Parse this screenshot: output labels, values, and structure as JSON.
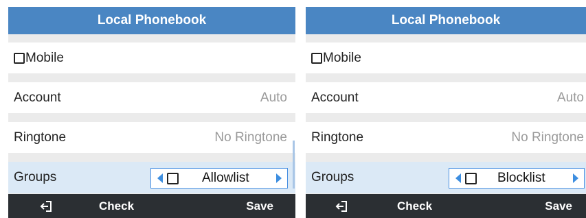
{
  "panels": [
    {
      "title": "Local Phonebook",
      "mobile_label": "Mobile",
      "account_label": "Account",
      "account_value": "Auto",
      "ringtone_label": "Ringtone",
      "ringtone_value": "No Ringtone",
      "groups_label": "Groups",
      "groups_value": "Allowlist",
      "softkeys": {
        "check": "Check",
        "save": "Save"
      }
    },
    {
      "title": "Local Phonebook",
      "mobile_label": "Mobile",
      "account_label": "Account",
      "account_value": "Auto",
      "ringtone_label": "Ringtone",
      "ringtone_value": "No Ringtone",
      "groups_label": "Groups",
      "groups_value": "Blocklist",
      "softkeys": {
        "check": "Check",
        "save": "Save"
      }
    }
  ],
  "colors": {
    "title_bar": "#4a86c3",
    "softkey_bar": "#2b2f33",
    "selected_row": "#dbe9f6",
    "accent_arrow": "#3d8ee0"
  },
  "icons": {
    "back": "exit-arrow-icon",
    "checkbox": "checkbox-empty-icon",
    "left_arrow": "triangle-left-icon",
    "right_arrow": "triangle-right-icon"
  }
}
